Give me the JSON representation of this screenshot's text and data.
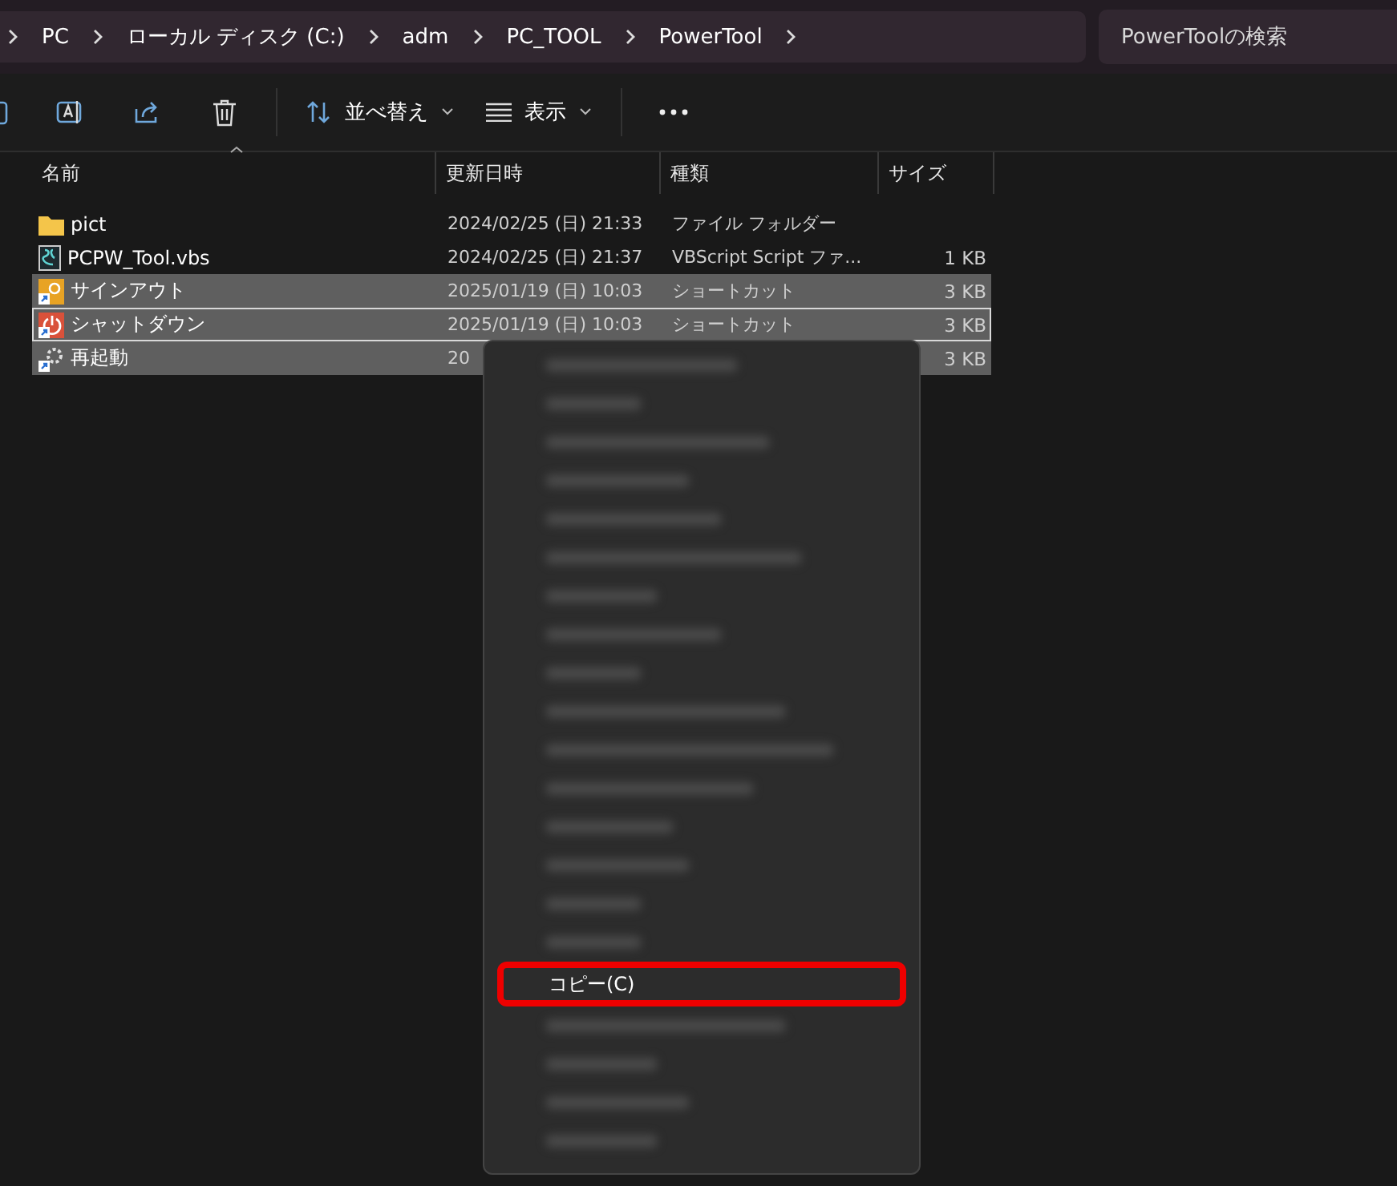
{
  "address_bar": {
    "crumbs": [
      "PC",
      "ローカル ディスク (C:)",
      "adm",
      "PC_TOOL",
      "PowerTool"
    ]
  },
  "search": {
    "placeholder": "PowerToolの検索"
  },
  "toolbar": {
    "buttons": [
      {
        "kind": "cut-off"
      },
      {
        "kind": "rename"
      },
      {
        "kind": "share"
      },
      {
        "kind": "delete"
      },
      {
        "kind": "sort",
        "label": "並べ替え"
      },
      {
        "kind": "view",
        "label": "表示"
      },
      {
        "kind": "more"
      }
    ]
  },
  "table": {
    "columns": [
      "名前",
      "更新日時",
      "種類",
      "サイズ"
    ],
    "rows": [
      {
        "kind": "folder",
        "name": "pict",
        "date": "2024/02/25 (日) 21:33",
        "type": "ファイル フォルダー",
        "size": "",
        "selected": false,
        "focused": false
      },
      {
        "kind": "script",
        "name": "PCPW_Tool.vbs",
        "date": "2024/02/25 (日) 21:37",
        "type": "VBScript Script ファ...",
        "size": "1 KB",
        "selected": false,
        "focused": false
      },
      {
        "kind": "signout",
        "name": "サインアウト",
        "date": "2025/01/19 (日) 10:03",
        "type": "ショートカット",
        "size": "3 KB",
        "selected": true,
        "focused": false
      },
      {
        "kind": "shutdown",
        "name": "シャットダウン",
        "date": "2025/01/19 (日) 10:03",
        "type": "ショートカット",
        "size": "3 KB",
        "selected": true,
        "focused": true
      },
      {
        "kind": "restart",
        "name": "再起動",
        "date": "20",
        "type": "",
        "size": "3 KB",
        "selected": true,
        "focused": false
      }
    ]
  },
  "context_menu": {
    "items": [
      {
        "kind": "blurred"
      },
      {
        "kind": "blurred"
      },
      {
        "kind": "blurred"
      },
      {
        "kind": "blurred"
      },
      {
        "kind": "blurred"
      },
      {
        "kind": "blurred"
      },
      {
        "kind": "blurred"
      },
      {
        "kind": "blurred"
      },
      {
        "kind": "blurred"
      },
      {
        "kind": "blurred"
      },
      {
        "kind": "blurred"
      },
      {
        "kind": "blurred"
      },
      {
        "kind": "blurred"
      },
      {
        "kind": "blurred"
      },
      {
        "kind": "blurred"
      },
      {
        "kind": "blurred"
      },
      {
        "kind": "text",
        "label": "コピー(C)",
        "highlighted": true
      },
      {
        "kind": "blurred"
      },
      {
        "kind": "blurred"
      },
      {
        "kind": "blurred"
      },
      {
        "kind": "blurred"
      }
    ]
  }
}
